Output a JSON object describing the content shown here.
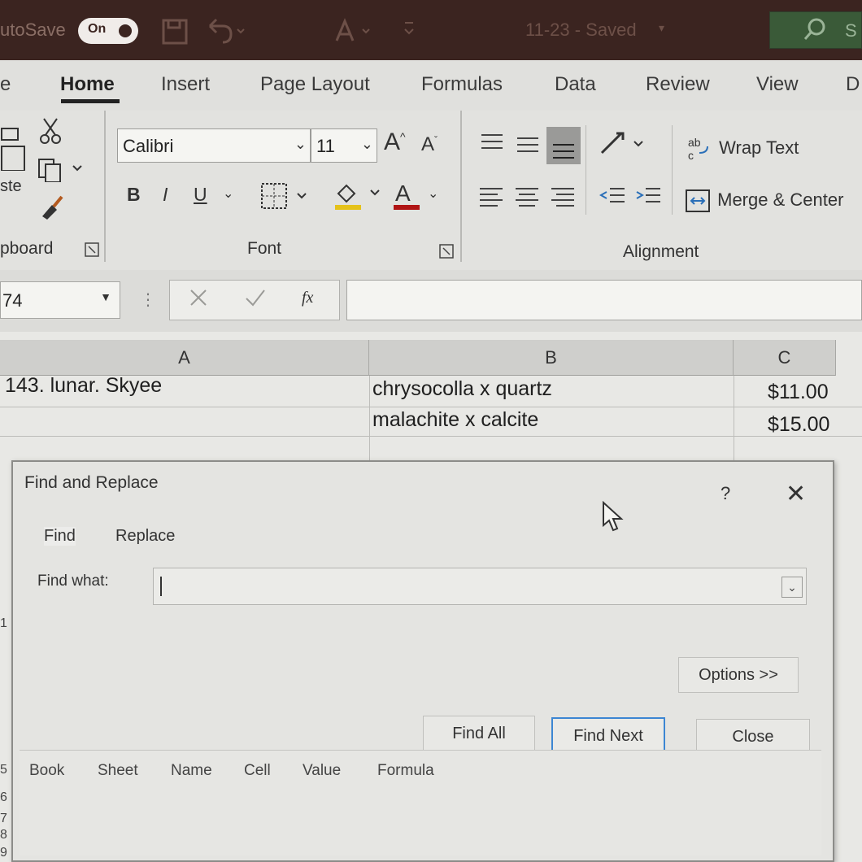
{
  "titlebar": {
    "autosave_label": "utoSave",
    "toggle_state": "On",
    "document_title": "11-23 - Saved",
    "search_label": "S"
  },
  "tabs": {
    "items": [
      {
        "label": "e"
      },
      {
        "label": "Home"
      },
      {
        "label": "Insert"
      },
      {
        "label": "Page Layout"
      },
      {
        "label": "Formulas"
      },
      {
        "label": "Data"
      },
      {
        "label": "Review"
      },
      {
        "label": "View"
      },
      {
        "label": "D"
      }
    ],
    "active": "Home"
  },
  "ribbon": {
    "clipboard": {
      "group_label": "pboard",
      "paste_label": "ste"
    },
    "font": {
      "group_label": "Font",
      "font_name": "Calibri",
      "font_size": "11",
      "bold_label": "B",
      "italic_label": "I",
      "underline_label": "U",
      "grow_label": "A",
      "shrink_label": "A",
      "font_color_label": "A",
      "fill_color": "#e5c21a",
      "font_color": "#b01414"
    },
    "alignment": {
      "group_label": "Alignment",
      "wrap_text_label": "Wrap Text",
      "merge_center_label": "Merge & Center"
    }
  },
  "formula_bar": {
    "name_box": "74",
    "fx_label": "fx",
    "formula_value": ""
  },
  "sheet": {
    "columns": [
      "A",
      "B",
      "C"
    ],
    "rows": [
      {
        "a": "143. lunar. Skyee",
        "b": "chrysocolla x quartz",
        "c": "$11.00"
      },
      {
        "a": "",
        "b": "malachite x calcite",
        "c": "$15.00"
      }
    ],
    "visible_row_numbers": [
      "1",
      "5",
      "6",
      "7",
      "8",
      "9"
    ]
  },
  "dialog": {
    "title": "Find and Replace",
    "help_label": "?",
    "close_glyph": "✕",
    "tabs": [
      {
        "label": "Find"
      },
      {
        "label": "Replace"
      }
    ],
    "active_tab": "Find",
    "find_what_label": "Find what:",
    "find_what_value": "",
    "options_label": "Options >>",
    "find_all_label": "Find All",
    "find_next_label": "Find Next",
    "close_label": "Close",
    "result_columns": [
      "Book",
      "Sheet",
      "Name",
      "Cell",
      "Value",
      "Formula"
    ]
  }
}
